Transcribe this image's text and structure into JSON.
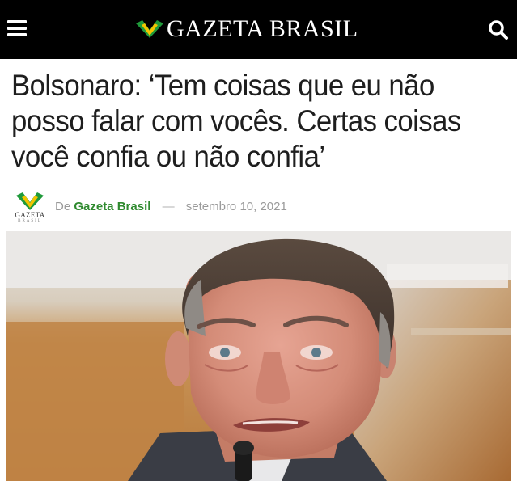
{
  "header": {
    "brand_name": "GAZETA BRASIL",
    "menu_icon": "hamburger-menu-icon",
    "search_icon": "search-icon",
    "background_color": "#000000",
    "logo_colors": {
      "green": "#1f9a3a",
      "yellow": "#f2c500"
    }
  },
  "article": {
    "headline": "Bolsonaro: ‘Tem coisas que eu não posso falar com vocês. Certas coisas você confia ou não confia’",
    "byline": {
      "prefix": "De",
      "author": "Gazeta Brasil",
      "separator": "—",
      "date": "setembro 10, 2021",
      "author_avatar_text": "GAZETA",
      "author_avatar_subtext": "BRASIL",
      "author_color": "#2f8a2f"
    },
    "photo": {
      "subject": "man-speaking-at-microphone",
      "background": "wood-panel-wall"
    }
  }
}
